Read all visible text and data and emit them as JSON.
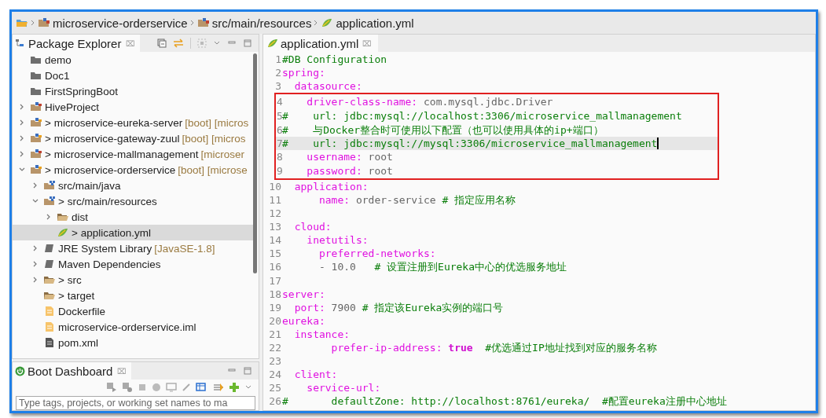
{
  "breadcrumb": [
    {
      "kind": "workspace"
    },
    {
      "kind": "project",
      "label": "microservice-orderservice"
    },
    {
      "kind": "package",
      "label": "src/main/resources"
    },
    {
      "kind": "yml",
      "label": "application.yml"
    }
  ],
  "package_explorer": {
    "title": "Package Explorer",
    "close": "⌧",
    "items": [
      {
        "kind": "folder",
        "label": "demo"
      },
      {
        "kind": "folder",
        "label": "Doc1"
      },
      {
        "kind": "folder",
        "label": "FirstSpringBoot"
      },
      {
        "kind": "project",
        "label": "HiveProject",
        "expanded": false
      },
      {
        "kind": "boot",
        "label": "> microservice-eureka-server",
        "decoration": "[boot] [micros",
        "expanded": false
      },
      {
        "kind": "boot",
        "label": "> microservice-gateway-zuul",
        "decoration": "[boot] [micros",
        "expanded": false
      },
      {
        "kind": "project",
        "label": "> microservice-mallmanagement",
        "decoration": "[microser",
        "expanded": false
      },
      {
        "kind": "boot",
        "label": "> microservice-orderservice",
        "decoration": "[boot] [microse",
        "expanded": true,
        "children": [
          {
            "kind": "package",
            "label": "src/main/java",
            "expanded": false
          },
          {
            "kind": "package",
            "label": "> src/main/resources",
            "expanded": true,
            "children": [
              {
                "kind": "openfolder",
                "label": "dist",
                "expanded": false
              },
              {
                "kind": "yml",
                "label": "> application.yml",
                "selected": true
              }
            ]
          },
          {
            "kind": "library",
            "label": "JRE System Library",
            "decoration": "[JavaSE-1.8]",
            "expanded": false
          },
          {
            "kind": "library",
            "label": "Maven Dependencies",
            "expanded": false
          },
          {
            "kind": "openfolder",
            "label": "> src",
            "expanded": false
          },
          {
            "kind": "openfolder",
            "label": "> target"
          },
          {
            "kind": "file",
            "label": "Dockerfile"
          },
          {
            "kind": "file",
            "label": "microservice-orderservice.iml"
          },
          {
            "kind": "xml",
            "label": "pom.xml"
          }
        ]
      }
    ]
  },
  "boot_dashboard": {
    "title": "Boot Dashboard",
    "close": "⌧",
    "search": {
      "placeholder": "Type tags, projects, or working set names to ma"
    }
  },
  "editor": {
    "tab": {
      "label": "application.yml",
      "close": "⌧"
    },
    "lines": [
      {
        "n": "1",
        "highlighted": false,
        "segments": [
          {
            "kind": "comment",
            "text": "#DB Configuration"
          }
        ]
      },
      {
        "n": "2",
        "highlighted": false,
        "segments": [
          {
            "kind": "key",
            "text": "spring:"
          }
        ]
      },
      {
        "n": "3",
        "highlighted": false,
        "segments": [
          {
            "kind": "key",
            "text": "  datasource:"
          }
        ]
      },
      {
        "n": "4",
        "highlighted": true,
        "segments": [
          {
            "kind": "key",
            "text": "    driver-class-name:"
          },
          {
            "kind": "value",
            "text": " com.mysql.jdbc.Driver"
          }
        ]
      },
      {
        "n": "5",
        "highlighted": true,
        "segments": [
          {
            "kind": "comment",
            "text": "#    url: jdbc:mysql://localhost:3306/microservice_mallmanagement"
          }
        ]
      },
      {
        "n": "6",
        "highlighted": true,
        "segments": [
          {
            "kind": "comment",
            "text": "#    与Docker整合时可使用以下配置（也可以使用具体的ip+端口）"
          }
        ]
      },
      {
        "n": "7",
        "highlighted": true,
        "current": true,
        "segments": [
          {
            "kind": "comment",
            "text": "#    url: jdbc:mysql://mysql:3306/microservice_mallmanagement"
          }
        ]
      },
      {
        "n": "8",
        "highlighted": true,
        "segments": [
          {
            "kind": "key",
            "text": "    username:"
          },
          {
            "kind": "value",
            "text": " root"
          }
        ]
      },
      {
        "n": "9",
        "highlighted": true,
        "segments": [
          {
            "kind": "key",
            "text": "    password:"
          },
          {
            "kind": "value",
            "text": " root"
          }
        ]
      },
      {
        "n": "10",
        "highlighted": false,
        "segments": [
          {
            "kind": "key",
            "text": "  application:"
          }
        ]
      },
      {
        "n": "11",
        "highlighted": false,
        "segments": [
          {
            "kind": "key",
            "text": "      name:"
          },
          {
            "kind": "value",
            "text": " order-service "
          },
          {
            "kind": "comment",
            "text": "# 指定应用名称"
          }
        ]
      },
      {
        "n": "12",
        "highlighted": false
      },
      {
        "n": "13",
        "highlighted": false,
        "segments": [
          {
            "kind": "key",
            "text": "  cloud:"
          }
        ]
      },
      {
        "n": "14",
        "highlighted": false,
        "segments": [
          {
            "kind": "key",
            "text": "    inetutils:"
          }
        ]
      },
      {
        "n": "15",
        "highlighted": false,
        "segments": [
          {
            "kind": "key",
            "text": "      preferred-networks:"
          }
        ]
      },
      {
        "n": "16",
        "highlighted": false,
        "segments": [
          {
            "kind": "value",
            "text": "      - 10.0   "
          },
          {
            "kind": "comment",
            "text": "# 设置注册到Eureka中心的优选服务地址"
          }
        ]
      },
      {
        "n": "17",
        "highlighted": false
      },
      {
        "n": "18",
        "highlighted": false,
        "segments": [
          {
            "kind": "key",
            "text": "server:"
          }
        ]
      },
      {
        "n": "19",
        "highlighted": false,
        "segments": [
          {
            "kind": "key",
            "text": "  port:"
          },
          {
            "kind": "value",
            "text": " 7900 "
          },
          {
            "kind": "comment",
            "text": "# 指定该Eureka实例的端口号"
          }
        ]
      },
      {
        "n": "20",
        "highlighted": false,
        "segments": [
          {
            "kind": "key",
            "text": "eureka:"
          }
        ]
      },
      {
        "n": "21",
        "highlighted": false,
        "segments": [
          {
            "kind": "key",
            "text": "  instance:"
          }
        ]
      },
      {
        "n": "22",
        "highlighted": false,
        "segments": [
          {
            "kind": "key",
            "text": "        prefer-ip-address: "
          },
          {
            "kind": "keyword",
            "text": "true"
          },
          {
            "kind": "comment",
            "text": "  #优选通过IP地址找到对应的服务名称"
          }
        ]
      },
      {
        "n": "23",
        "highlighted": false
      },
      {
        "n": "24",
        "highlighted": false,
        "segments": [
          {
            "kind": "key",
            "text": "  client:"
          }
        ]
      },
      {
        "n": "25",
        "highlighted": false,
        "segments": [
          {
            "kind": "key",
            "text": "    service-url:"
          }
        ]
      },
      {
        "n": "26",
        "highlighted": false,
        "segments": [
          {
            "kind": "comment",
            "text": "#       defaultZone: http://localhost:8761/eureka/  #配置eureka注册中心地址"
          }
        ]
      }
    ]
  }
}
